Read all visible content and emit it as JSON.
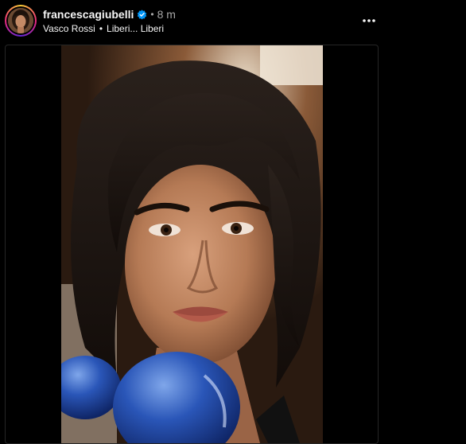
{
  "post": {
    "username": "francescagiubelli",
    "verified": true,
    "separator": "•",
    "time_ago": "8 m",
    "audio": {
      "artist": "Vasco Rossi",
      "bullet": "•",
      "track": "Liberi... Liberi"
    },
    "more_icon": "more-horizontal-icon",
    "verified_icon": "verified-badge-icon",
    "media": {
      "type": "image"
    }
  },
  "colors": {
    "background": "#000000",
    "text_primary": "#f5f5f5",
    "text_secondary": "#a8a8a8",
    "verified_blue": "#0095f6",
    "frame_border": "#262626"
  }
}
